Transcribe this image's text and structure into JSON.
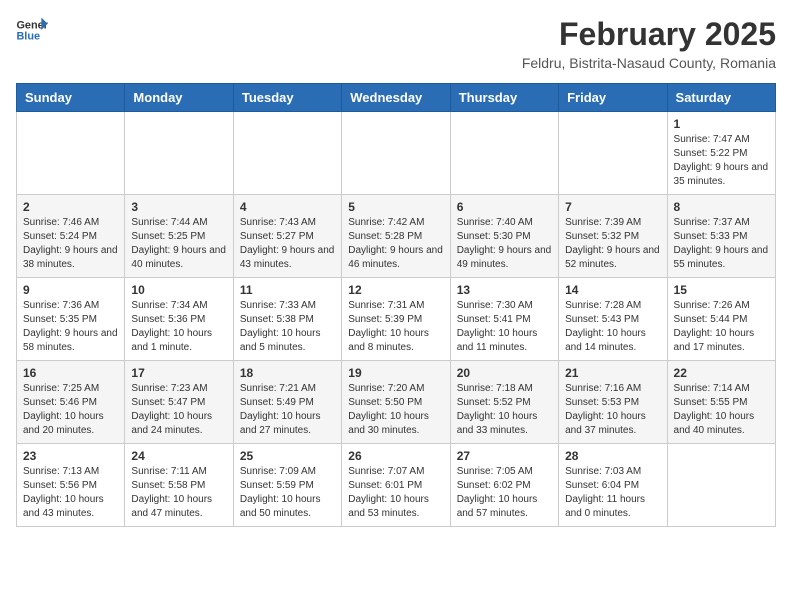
{
  "header": {
    "logo_line1": "General",
    "logo_line2": "Blue",
    "month_year": "February 2025",
    "location": "Feldru, Bistrita-Nasaud County, Romania"
  },
  "weekdays": [
    "Sunday",
    "Monday",
    "Tuesday",
    "Wednesday",
    "Thursday",
    "Friday",
    "Saturday"
  ],
  "weeks": [
    [
      {
        "day": "",
        "info": ""
      },
      {
        "day": "",
        "info": ""
      },
      {
        "day": "",
        "info": ""
      },
      {
        "day": "",
        "info": ""
      },
      {
        "day": "",
        "info": ""
      },
      {
        "day": "",
        "info": ""
      },
      {
        "day": "1",
        "info": "Sunrise: 7:47 AM\nSunset: 5:22 PM\nDaylight: 9 hours and 35 minutes."
      }
    ],
    [
      {
        "day": "2",
        "info": "Sunrise: 7:46 AM\nSunset: 5:24 PM\nDaylight: 9 hours and 38 minutes."
      },
      {
        "day": "3",
        "info": "Sunrise: 7:44 AM\nSunset: 5:25 PM\nDaylight: 9 hours and 40 minutes."
      },
      {
        "day": "4",
        "info": "Sunrise: 7:43 AM\nSunset: 5:27 PM\nDaylight: 9 hours and 43 minutes."
      },
      {
        "day": "5",
        "info": "Sunrise: 7:42 AM\nSunset: 5:28 PM\nDaylight: 9 hours and 46 minutes."
      },
      {
        "day": "6",
        "info": "Sunrise: 7:40 AM\nSunset: 5:30 PM\nDaylight: 9 hours and 49 minutes."
      },
      {
        "day": "7",
        "info": "Sunrise: 7:39 AM\nSunset: 5:32 PM\nDaylight: 9 hours and 52 minutes."
      },
      {
        "day": "8",
        "info": "Sunrise: 7:37 AM\nSunset: 5:33 PM\nDaylight: 9 hours and 55 minutes."
      }
    ],
    [
      {
        "day": "9",
        "info": "Sunrise: 7:36 AM\nSunset: 5:35 PM\nDaylight: 9 hours and 58 minutes."
      },
      {
        "day": "10",
        "info": "Sunrise: 7:34 AM\nSunset: 5:36 PM\nDaylight: 10 hours and 1 minute."
      },
      {
        "day": "11",
        "info": "Sunrise: 7:33 AM\nSunset: 5:38 PM\nDaylight: 10 hours and 5 minutes."
      },
      {
        "day": "12",
        "info": "Sunrise: 7:31 AM\nSunset: 5:39 PM\nDaylight: 10 hours and 8 minutes."
      },
      {
        "day": "13",
        "info": "Sunrise: 7:30 AM\nSunset: 5:41 PM\nDaylight: 10 hours and 11 minutes."
      },
      {
        "day": "14",
        "info": "Sunrise: 7:28 AM\nSunset: 5:43 PM\nDaylight: 10 hours and 14 minutes."
      },
      {
        "day": "15",
        "info": "Sunrise: 7:26 AM\nSunset: 5:44 PM\nDaylight: 10 hours and 17 minutes."
      }
    ],
    [
      {
        "day": "16",
        "info": "Sunrise: 7:25 AM\nSunset: 5:46 PM\nDaylight: 10 hours and 20 minutes."
      },
      {
        "day": "17",
        "info": "Sunrise: 7:23 AM\nSunset: 5:47 PM\nDaylight: 10 hours and 24 minutes."
      },
      {
        "day": "18",
        "info": "Sunrise: 7:21 AM\nSunset: 5:49 PM\nDaylight: 10 hours and 27 minutes."
      },
      {
        "day": "19",
        "info": "Sunrise: 7:20 AM\nSunset: 5:50 PM\nDaylight: 10 hours and 30 minutes."
      },
      {
        "day": "20",
        "info": "Sunrise: 7:18 AM\nSunset: 5:52 PM\nDaylight: 10 hours and 33 minutes."
      },
      {
        "day": "21",
        "info": "Sunrise: 7:16 AM\nSunset: 5:53 PM\nDaylight: 10 hours and 37 minutes."
      },
      {
        "day": "22",
        "info": "Sunrise: 7:14 AM\nSunset: 5:55 PM\nDaylight: 10 hours and 40 minutes."
      }
    ],
    [
      {
        "day": "23",
        "info": "Sunrise: 7:13 AM\nSunset: 5:56 PM\nDaylight: 10 hours and 43 minutes."
      },
      {
        "day": "24",
        "info": "Sunrise: 7:11 AM\nSunset: 5:58 PM\nDaylight: 10 hours and 47 minutes."
      },
      {
        "day": "25",
        "info": "Sunrise: 7:09 AM\nSunset: 5:59 PM\nDaylight: 10 hours and 50 minutes."
      },
      {
        "day": "26",
        "info": "Sunrise: 7:07 AM\nSunset: 6:01 PM\nDaylight: 10 hours and 53 minutes."
      },
      {
        "day": "27",
        "info": "Sunrise: 7:05 AM\nSunset: 6:02 PM\nDaylight: 10 hours and 57 minutes."
      },
      {
        "day": "28",
        "info": "Sunrise: 7:03 AM\nSunset: 6:04 PM\nDaylight: 11 hours and 0 minutes."
      },
      {
        "day": "",
        "info": ""
      }
    ]
  ]
}
